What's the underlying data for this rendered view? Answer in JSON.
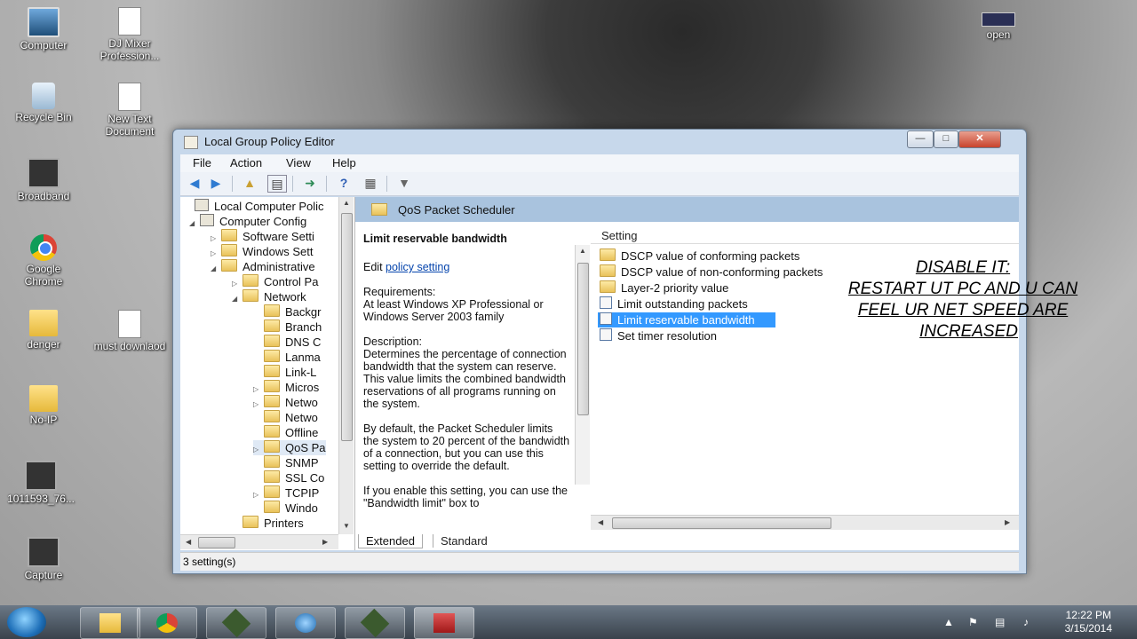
{
  "desktop": {
    "icons": [
      {
        "label": "Computer",
        "kind": "computer"
      },
      {
        "label": "DJ Mixer Profession...",
        "kind": "doc"
      },
      {
        "label": "Recycle Bin",
        "kind": "bin"
      },
      {
        "label": "New Text Document",
        "kind": "doc"
      },
      {
        "label": "Broadband",
        "kind": "dark"
      },
      {
        "label": "Google Chrome",
        "kind": "chrome"
      },
      {
        "label": "denger",
        "kind": "folder"
      },
      {
        "label": "must downlaod",
        "kind": "doc"
      },
      {
        "label": "No-IP",
        "kind": "folder"
      },
      {
        "label": "1011593_76...",
        "kind": "dark"
      },
      {
        "label": "Capture",
        "kind": "dark"
      },
      {
        "label": "open",
        "kind": "open"
      }
    ]
  },
  "window": {
    "title": "Local Group Policy Editor",
    "menu": [
      "File",
      "Action",
      "View",
      "Help"
    ],
    "tree": [
      "Local Computer Polic",
      "Computer Config",
      "Software Setti",
      "Windows Sett",
      "Administrative",
      "Control Pa",
      "Network",
      "Backgr",
      "Branch",
      "DNS C",
      "Lanma",
      "Link-L",
      "Micros",
      "Netwo",
      "Netwo",
      "Offline",
      "QoS Pa",
      "SNMP",
      "SSL Co",
      "TCPIP",
      "Windo",
      "Printers"
    ],
    "header_title": "QoS Packet Scheduler",
    "description": {
      "title": "Limit reservable bandwidth",
      "edit_prefix": "Edit",
      "edit_link": "policy setting",
      "requirements": "Requirements:\nAt least Windows XP Professional or Windows Server 2003 family",
      "description": "Description:\nDetermines the percentage of connection bandwidth that the system can reserve. This value limits the combined bandwidth reservations of all programs running on the system.",
      "default": "By default, the Packet Scheduler limits the system to 20 percent of the bandwidth of a connection, but you can use this setting to override the default.",
      "enable": "If you enable this setting, you can use the \"Bandwidth limit\" box to"
    },
    "tabs": [
      "Extended",
      "Standard"
    ],
    "list_header": "Setting",
    "settings": [
      {
        "label": "DSCP value of conforming packets",
        "type": "folder"
      },
      {
        "label": "DSCP value of non-conforming packets",
        "type": "folder"
      },
      {
        "label": "Layer-2 priority value",
        "type": "folder"
      },
      {
        "label": "Limit outstanding packets",
        "type": "policy"
      },
      {
        "label": "Limit reservable bandwidth",
        "type": "policy",
        "selected": true
      },
      {
        "label": "Set timer resolution",
        "type": "policy"
      }
    ],
    "status": "3 setting(s)"
  },
  "overlay": {
    "line1": "DISABLE IT:",
    "line2": "RESTART UT PC AND U CAN",
    "line3": "FEEL  UR NET SPEED ARE",
    "line4": "INCREASED"
  },
  "taskbar": {
    "time": "12:22 PM",
    "date": "3/15/2014"
  },
  "colors": {
    "selection": "#3399ff",
    "header_band": "#a9c3de",
    "link": "#0645ad"
  }
}
